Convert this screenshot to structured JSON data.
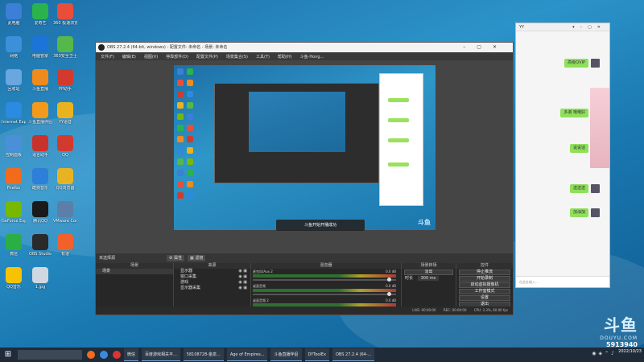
{
  "desktop": {
    "icons": [
      {
        "label": "此电脑",
        "color": "#3b7fd6"
      },
      {
        "label": "爱奇艺",
        "color": "#2ab34a"
      },
      {
        "label": "360 极速浏览器",
        "color": "#e94e3b"
      },
      {
        "label": "网络",
        "color": "#3c8fd9"
      },
      {
        "label": "电脑管家",
        "color": "#1c74d8"
      },
      {
        "label": "360安全卫士",
        "color": "#55b84a"
      },
      {
        "label": "回收站",
        "color": "#6aa6e0"
      },
      {
        "label": "斗鱼直播",
        "color": "#f08a1c"
      },
      {
        "label": "PP助手",
        "color": "#d23a2e"
      },
      {
        "label": "Internet Explorer",
        "color": "#2a8be0"
      },
      {
        "label": "斗鱼直播伴侣",
        "color": "#f39a1d"
      },
      {
        "label": "YY语音",
        "color": "#e9b320"
      },
      {
        "label": "控制面板",
        "color": "#4a90d9"
      },
      {
        "label": "语言助手",
        "color": "#c9322a"
      },
      {
        "label": "QQ",
        "color": "#d23a2e"
      },
      {
        "label": "Firefox",
        "color": "#f26b1c"
      },
      {
        "label": "酷狗音乐",
        "color": "#2d7fd8"
      },
      {
        "label": "QQ浏览器",
        "color": "#e8b323"
      },
      {
        "label": "GeForce Experience",
        "color": "#76b900"
      },
      {
        "label": "腾讯QQ",
        "color": "#1a1a1a"
      },
      {
        "label": "VMware Core",
        "color": "#5b7fa8"
      },
      {
        "label": "微信",
        "color": "#2bae44"
      },
      {
        "label": "OBS Studio",
        "color": "#2a2a2a"
      },
      {
        "label": "有道",
        "color": "#f2612a"
      },
      {
        "label": "QQ音乐",
        "color": "#f7c300"
      },
      {
        "label": "1.jpg",
        "color": "#cfd8e0"
      }
    ]
  },
  "obs": {
    "title": "OBS 27.2.4 (64-bit, windows) - 配置文件: 未命名 - 场景: 未命名",
    "menu": [
      "文件(F)",
      "编辑(E)",
      "视图(V)",
      "停靠部件(D)",
      "配置文件(P)",
      "场景集合(S)",
      "工具(T)",
      "帮助(H)",
      "斗鱼-Hong..."
    ],
    "toast": "斗鱼开始开播成功",
    "dock_toolbar": {
      "no_source": "未选择源",
      "properties": "属性",
      "filters": "滤镜"
    },
    "scenes": {
      "header": "场景",
      "items": [
        "场景"
      ]
    },
    "sources": {
      "header": "来源",
      "items": [
        "显示器",
        "窗口采集",
        "游戏",
        "显示器采集"
      ]
    },
    "mixer": {
      "header": "混音器",
      "channels": [
        {
          "name": "麦克风/Aux 2",
          "db": "0.0 dB"
        },
        {
          "name": "桌面音频",
          "db": "0.0 dB"
        },
        {
          "name": "桌面音频 2",
          "db": "0.0 dB"
        }
      ]
    },
    "transitions": {
      "header": "场景转场",
      "type": "淡出",
      "duration_label": "时长",
      "duration": "300 ms"
    },
    "controls": {
      "header": "控件",
      "buttons": [
        "停止推流",
        "开始录制",
        "启动虚拟摄像机",
        "工作室模式",
        "设置",
        "退出"
      ]
    },
    "status": {
      "live": "LIVE: 00:00:00",
      "rec": "REC: 00:00:00",
      "cpu": "CPU: 3.3%, 60.00 fps"
    },
    "footer": {
      "add": "+",
      "remove": "−",
      "up": "∧",
      "down": "∨"
    }
  },
  "chat": {
    "title": "YY",
    "messages": [
      "高级QVIP",
      "多谢 哦哦好",
      "说说话",
      "送送送",
      "加油加"
    ],
    "input_placeholder": "在此处输入..."
  },
  "watermark": {
    "logo": "斗鱼",
    "domain": "DOUYU.COM",
    "room_id": "5913940"
  },
  "taskbar": {
    "tasks": [
      "微信",
      "百度游戏相关平...",
      "58108728-金泉...",
      "Age of Empires...",
      "斗鱼直播伴侣",
      "DYToolEx",
      "OBS 27.2.4 (64-..."
    ],
    "time": "2022/10/23"
  }
}
